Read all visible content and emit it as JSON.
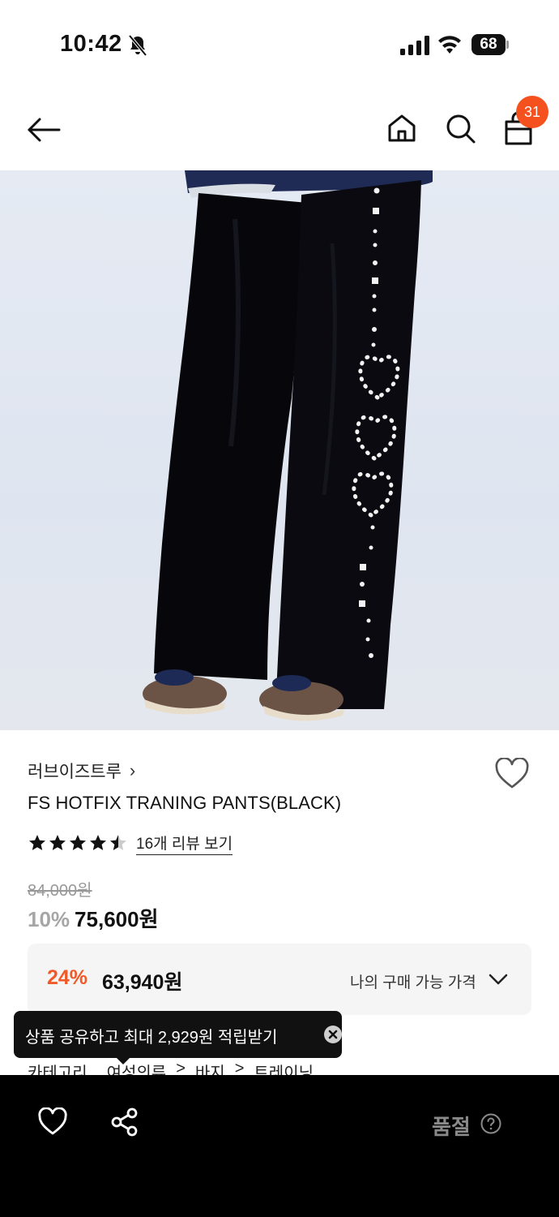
{
  "status_bar": {
    "time": "10:42",
    "battery": "68"
  },
  "nav": {
    "cart_count": "31"
  },
  "hero": {
    "image_alt": "black wide training pants with white studded hearts and stars"
  },
  "product": {
    "brand": "러브이즈트루",
    "brand_chevron": "›",
    "name": "FS HOTFIX TRANING PANTS(BLACK)",
    "rating": 4.5,
    "review_link": "16개 리뷰 보기",
    "original_price": "84,000원",
    "discount_rate": "10%",
    "sale_price": "75,600원"
  },
  "my_price": {
    "discount_rate": "24%",
    "price": "63,940원",
    "label": "나의 구매 가능 가격"
  },
  "tooltip": {
    "text": "상품 공유하고 최대 2,929원 적립받기"
  },
  "category": {
    "label": "카테고리",
    "path": [
      "여성의류",
      ">",
      "바지",
      ">",
      "트레이닝"
    ]
  },
  "bottom_bar": {
    "status": "품절"
  },
  "colors": {
    "accent": "#f05a28",
    "badge": "#f4511e",
    "bar": "#000000"
  },
  "icons": [
    "back-arrow-icon",
    "home-icon",
    "search-icon",
    "shopping-bag-icon",
    "heart-icon",
    "share-icon",
    "help-icon",
    "close-icon",
    "chevron-down-icon",
    "star-icon"
  ]
}
